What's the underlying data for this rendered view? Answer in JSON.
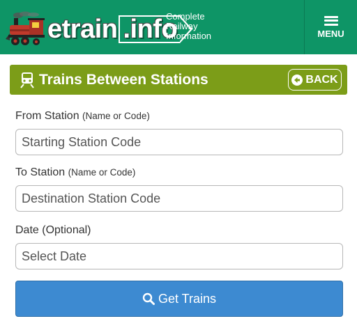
{
  "header": {
    "brand_main": "etrain",
    "brand_tld": ".info",
    "tagline": [
      "Complete",
      "Railway",
      "Information"
    ],
    "menu_label": "MENU",
    "bg_color": "#0e9566"
  },
  "section": {
    "title": "Trains Between Stations",
    "back_label": "BACK",
    "bg_color": "#7c9d18",
    "icon": "train-icon"
  },
  "form": {
    "from": {
      "label": "From Station",
      "hint": "(Name or Code)",
      "placeholder": "Starting Station Code",
      "value": ""
    },
    "to": {
      "label": "To Station",
      "hint": "(Name or Code)",
      "placeholder": "Destination Station Code",
      "value": ""
    },
    "date": {
      "label": "Date (Optional)",
      "placeholder": "Select Date",
      "value": ""
    },
    "submit_label": "Get Trains",
    "submit_color": "#3d8ad1"
  }
}
